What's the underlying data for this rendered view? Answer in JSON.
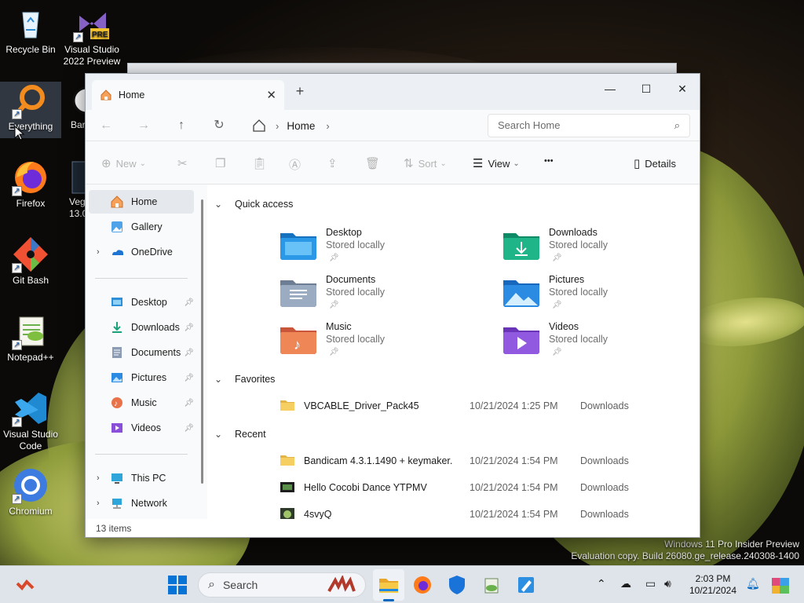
{
  "desktop": {
    "icons": [
      {
        "label": "Recycle Bin",
        "name": "recycle-bin"
      },
      {
        "label": "Visual Studio 2022 Preview",
        "name": "visual-studio-2022-preview",
        "badge": "PRE"
      },
      {
        "label": "Everything",
        "name": "everything"
      },
      {
        "label": "Bar",
        "name": "bandicam"
      },
      {
        "label": "Firefox",
        "name": "firefox"
      },
      {
        "label": "Veg 13.0",
        "name": "vegas"
      },
      {
        "label": "Git Bash",
        "name": "git-bash"
      },
      {
        "label": "Notepad++",
        "name": "notepad-plus-plus"
      },
      {
        "label": "Visual Studio Code",
        "name": "visual-studio-code"
      },
      {
        "label": "Chromium",
        "name": "chromium"
      }
    ],
    "watermark": {
      "line1": "Windows 11 Pro Insider Preview",
      "line2": "Evaluation copy. Build 26080.ge_release.240308-1400"
    }
  },
  "explorer": {
    "tab_title": "Home",
    "address": {
      "crumb": "Home"
    },
    "search_placeholder": "Search Home",
    "commands": {
      "new": "New",
      "sort": "Sort",
      "view": "View",
      "more": "•••",
      "details": "Details"
    },
    "sidebar": {
      "top": [
        {
          "label": "Home",
          "icon": "home-icon",
          "selected": true
        },
        {
          "label": "Gallery",
          "icon": "gallery-icon"
        },
        {
          "label": "OneDrive",
          "icon": "onedrive-icon",
          "expandable": true
        }
      ],
      "pinned": [
        {
          "label": "Desktop",
          "icon": "desktop-folder-icon"
        },
        {
          "label": "Downloads",
          "icon": "downloads-folder-icon"
        },
        {
          "label": "Documents",
          "icon": "documents-folder-icon"
        },
        {
          "label": "Pictures",
          "icon": "pictures-folder-icon"
        },
        {
          "label": "Music",
          "icon": "music-folder-icon"
        },
        {
          "label": "Videos",
          "icon": "videos-folder-icon"
        }
      ],
      "bottom": [
        {
          "label": "This PC",
          "icon": "this-pc-icon"
        },
        {
          "label": "Network",
          "icon": "network-icon"
        }
      ]
    },
    "sections": {
      "quick_access": "Quick access",
      "favorites": "Favorites",
      "recent": "Recent"
    },
    "quick_access": [
      {
        "name": "Desktop",
        "status": "Stored locally",
        "color": "#1e8fd8"
      },
      {
        "name": "Downloads",
        "status": "Stored locally",
        "color": "#1aa37a"
      },
      {
        "name": "Documents",
        "status": "Stored locally",
        "color": "#7d8fa8"
      },
      {
        "name": "Pictures",
        "status": "Stored locally",
        "color": "#2b8ae2"
      },
      {
        "name": "Music",
        "status": "Stored locally",
        "color": "#e8734a"
      },
      {
        "name": "Videos",
        "status": "Stored locally",
        "color": "#8a4fd8"
      }
    ],
    "favorites": [
      {
        "name": "VBCABLE_Driver_Pack45",
        "date": "10/21/2024 1:25 PM",
        "location": "Downloads"
      }
    ],
    "recent": [
      {
        "name": "Bandicam 4.3.1.1490 + keymaker...",
        "date": "10/21/2024 1:54 PM",
        "location": "Downloads"
      },
      {
        "name": "Hello Cocobi Dance YTPMV",
        "date": "10/21/2024 1:54 PM",
        "location": "Downloads"
      },
      {
        "name": "4svyQ",
        "date": "10/21/2024 1:54 PM",
        "location": "Downloads"
      }
    ],
    "status": "13 items"
  },
  "taskbar": {
    "search_label": "Search",
    "clock_time": "2:03 PM",
    "clock_date": "10/21/2024",
    "accent": "#0067c0"
  }
}
